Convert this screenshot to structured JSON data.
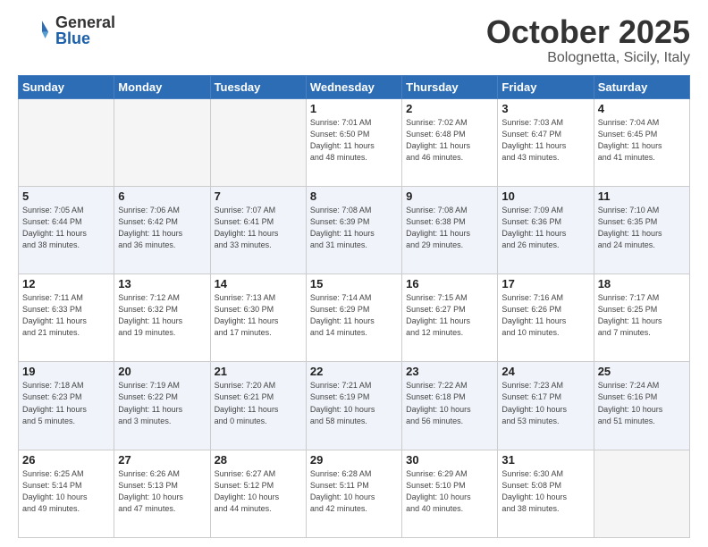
{
  "logo": {
    "general": "General",
    "blue": "Blue"
  },
  "title": "October 2025",
  "location": "Bolognetta, Sicily, Italy",
  "headers": [
    "Sunday",
    "Monday",
    "Tuesday",
    "Wednesday",
    "Thursday",
    "Friday",
    "Saturday"
  ],
  "weeks": [
    [
      {
        "day": "",
        "info": ""
      },
      {
        "day": "",
        "info": ""
      },
      {
        "day": "",
        "info": ""
      },
      {
        "day": "1",
        "info": "Sunrise: 7:01 AM\nSunset: 6:50 PM\nDaylight: 11 hours\nand 48 minutes."
      },
      {
        "day": "2",
        "info": "Sunrise: 7:02 AM\nSunset: 6:48 PM\nDaylight: 11 hours\nand 46 minutes."
      },
      {
        "day": "3",
        "info": "Sunrise: 7:03 AM\nSunset: 6:47 PM\nDaylight: 11 hours\nand 43 minutes."
      },
      {
        "day": "4",
        "info": "Sunrise: 7:04 AM\nSunset: 6:45 PM\nDaylight: 11 hours\nand 41 minutes."
      }
    ],
    [
      {
        "day": "5",
        "info": "Sunrise: 7:05 AM\nSunset: 6:44 PM\nDaylight: 11 hours\nand 38 minutes."
      },
      {
        "day": "6",
        "info": "Sunrise: 7:06 AM\nSunset: 6:42 PM\nDaylight: 11 hours\nand 36 minutes."
      },
      {
        "day": "7",
        "info": "Sunrise: 7:07 AM\nSunset: 6:41 PM\nDaylight: 11 hours\nand 33 minutes."
      },
      {
        "day": "8",
        "info": "Sunrise: 7:08 AM\nSunset: 6:39 PM\nDaylight: 11 hours\nand 31 minutes."
      },
      {
        "day": "9",
        "info": "Sunrise: 7:08 AM\nSunset: 6:38 PM\nDaylight: 11 hours\nand 29 minutes."
      },
      {
        "day": "10",
        "info": "Sunrise: 7:09 AM\nSunset: 6:36 PM\nDaylight: 11 hours\nand 26 minutes."
      },
      {
        "day": "11",
        "info": "Sunrise: 7:10 AM\nSunset: 6:35 PM\nDaylight: 11 hours\nand 24 minutes."
      }
    ],
    [
      {
        "day": "12",
        "info": "Sunrise: 7:11 AM\nSunset: 6:33 PM\nDaylight: 11 hours\nand 21 minutes."
      },
      {
        "day": "13",
        "info": "Sunrise: 7:12 AM\nSunset: 6:32 PM\nDaylight: 11 hours\nand 19 minutes."
      },
      {
        "day": "14",
        "info": "Sunrise: 7:13 AM\nSunset: 6:30 PM\nDaylight: 11 hours\nand 17 minutes."
      },
      {
        "day": "15",
        "info": "Sunrise: 7:14 AM\nSunset: 6:29 PM\nDaylight: 11 hours\nand 14 minutes."
      },
      {
        "day": "16",
        "info": "Sunrise: 7:15 AM\nSunset: 6:27 PM\nDaylight: 11 hours\nand 12 minutes."
      },
      {
        "day": "17",
        "info": "Sunrise: 7:16 AM\nSunset: 6:26 PM\nDaylight: 11 hours\nand 10 minutes."
      },
      {
        "day": "18",
        "info": "Sunrise: 7:17 AM\nSunset: 6:25 PM\nDaylight: 11 hours\nand 7 minutes."
      }
    ],
    [
      {
        "day": "19",
        "info": "Sunrise: 7:18 AM\nSunset: 6:23 PM\nDaylight: 11 hours\nand 5 minutes."
      },
      {
        "day": "20",
        "info": "Sunrise: 7:19 AM\nSunset: 6:22 PM\nDaylight: 11 hours\nand 3 minutes."
      },
      {
        "day": "21",
        "info": "Sunrise: 7:20 AM\nSunset: 6:21 PM\nDaylight: 11 hours\nand 0 minutes."
      },
      {
        "day": "22",
        "info": "Sunrise: 7:21 AM\nSunset: 6:19 PM\nDaylight: 10 hours\nand 58 minutes."
      },
      {
        "day": "23",
        "info": "Sunrise: 7:22 AM\nSunset: 6:18 PM\nDaylight: 10 hours\nand 56 minutes."
      },
      {
        "day": "24",
        "info": "Sunrise: 7:23 AM\nSunset: 6:17 PM\nDaylight: 10 hours\nand 53 minutes."
      },
      {
        "day": "25",
        "info": "Sunrise: 7:24 AM\nSunset: 6:16 PM\nDaylight: 10 hours\nand 51 minutes."
      }
    ],
    [
      {
        "day": "26",
        "info": "Sunrise: 6:25 AM\nSunset: 5:14 PM\nDaylight: 10 hours\nand 49 minutes."
      },
      {
        "day": "27",
        "info": "Sunrise: 6:26 AM\nSunset: 5:13 PM\nDaylight: 10 hours\nand 47 minutes."
      },
      {
        "day": "28",
        "info": "Sunrise: 6:27 AM\nSunset: 5:12 PM\nDaylight: 10 hours\nand 44 minutes."
      },
      {
        "day": "29",
        "info": "Sunrise: 6:28 AM\nSunset: 5:11 PM\nDaylight: 10 hours\nand 42 minutes."
      },
      {
        "day": "30",
        "info": "Sunrise: 6:29 AM\nSunset: 5:10 PM\nDaylight: 10 hours\nand 40 minutes."
      },
      {
        "day": "31",
        "info": "Sunrise: 6:30 AM\nSunset: 5:08 PM\nDaylight: 10 hours\nand 38 minutes."
      },
      {
        "day": "",
        "info": ""
      }
    ]
  ]
}
